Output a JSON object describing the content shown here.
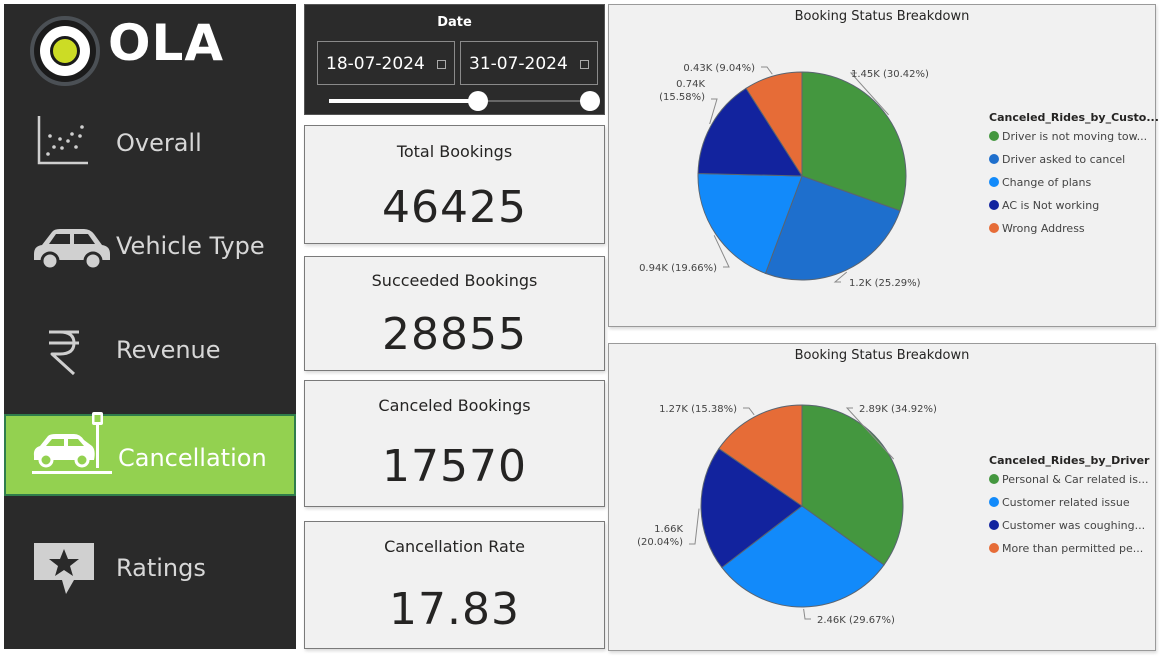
{
  "brand": {
    "name": "OLA"
  },
  "nav": {
    "items": [
      {
        "label": "Overall",
        "icon": "scatter-chart-icon"
      },
      {
        "label": "Vehicle Type",
        "icon": "car-icon"
      },
      {
        "label": "Revenue",
        "icon": "rupee-icon"
      },
      {
        "label": "Cancellation",
        "icon": "car-crash-icon",
        "active": true
      },
      {
        "label": "Ratings",
        "icon": "star-comment-icon"
      }
    ]
  },
  "date_filter": {
    "title": "Date",
    "start": "18-07-2024",
    "end": "31-07-2024"
  },
  "kpis": [
    {
      "title": "Total Bookings",
      "value": "46425"
    },
    {
      "title": "Succeeded Bookings",
      "value": "28855"
    },
    {
      "title": "Canceled Bookings",
      "value": "17570"
    },
    {
      "title": "Cancellation Rate",
      "value": "17.83"
    }
  ],
  "colors": {
    "green": "#44973f",
    "blue": "#1e6fcd",
    "light_blue": "#128afa",
    "navy": "#12239e",
    "orange": "#e66c37",
    "active_nav": "#93d150"
  },
  "chart_data": [
    {
      "type": "pie",
      "title": "Booking Status Breakdown",
      "legend_title": "Canceled_Rides_by_Custo...",
      "legend_position": "right",
      "slices": [
        {
          "name": "Driver is not moving tow...",
          "value": 1.45,
          "percent": 30.42,
          "label": "1.45K (30.42%)",
          "color": "#44973f"
        },
        {
          "name": "Driver asked to cancel",
          "value": 1.2,
          "percent": 25.29,
          "label": "1.2K (25.29%)",
          "color": "#1e6fcd"
        },
        {
          "name": "Change of plans",
          "value": 0.94,
          "percent": 19.66,
          "label": "0.94K (19.66%)",
          "color": "#128afa"
        },
        {
          "name": "AC is Not working",
          "value": 0.74,
          "percent": 15.58,
          "label_line1": "0.74K",
          "label_line2": "(15.58%)",
          "color": "#12239e"
        },
        {
          "name": "Wrong Address",
          "value": 0.43,
          "percent": 9.04,
          "label": "0.43K (9.04%)",
          "color": "#e66c37"
        }
      ]
    },
    {
      "type": "pie",
      "title": "Booking Status Breakdown",
      "legend_title": "Canceled_Rides_by_Driver",
      "legend_position": "right",
      "slices": [
        {
          "name": "Personal & Car related is...",
          "value": 2.89,
          "percent": 34.92,
          "label": "2.89K (34.92%)",
          "color": "#44973f"
        },
        {
          "name": "Customer related issue",
          "value": 2.46,
          "percent": 29.67,
          "label": "2.46K (29.67%)",
          "color": "#128afa"
        },
        {
          "name": "Customer was coughing...",
          "value": 1.66,
          "percent": 20.04,
          "label_line1": "1.66K",
          "label_line2": "(20.04%)",
          "color": "#12239e"
        },
        {
          "name": "More than permitted pe...",
          "value": 1.27,
          "percent": 15.38,
          "label": "1.27K (15.38%)",
          "color": "#e66c37"
        }
      ]
    }
  ]
}
